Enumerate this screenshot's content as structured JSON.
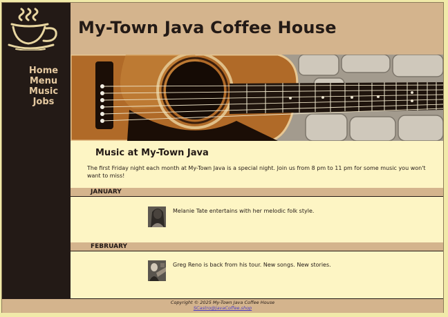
{
  "site": {
    "title": "My-Town Java Coffee House"
  },
  "nav": [
    {
      "label": "Home"
    },
    {
      "label": "Menu"
    },
    {
      "label": "Music"
    },
    {
      "label": "Jobs"
    }
  ],
  "page": {
    "heading": "Music at My-Town Java",
    "intro": "The first Friday night each month at My-Town Java is a special night. Join us from 8 pm to 11 pm for some music you won't want to miss!"
  },
  "months": [
    {
      "name": "JANUARY",
      "event": "Melanie Tate entertains with her melodic folk style."
    },
    {
      "name": "FEBRUARY",
      "event": "Greg Reno is back from his tour. New songs. New stories."
    }
  ],
  "footer": {
    "copyright": "Copyright © 2025 My-Town Java Coffee House",
    "email": "SCastro@JavaCoffee.shop"
  },
  "colors": {
    "sidebar": "#231a16",
    "accent": "#d4b48d",
    "content_bg": "#fdf5c4",
    "nav_text": "#e5c9a0"
  }
}
